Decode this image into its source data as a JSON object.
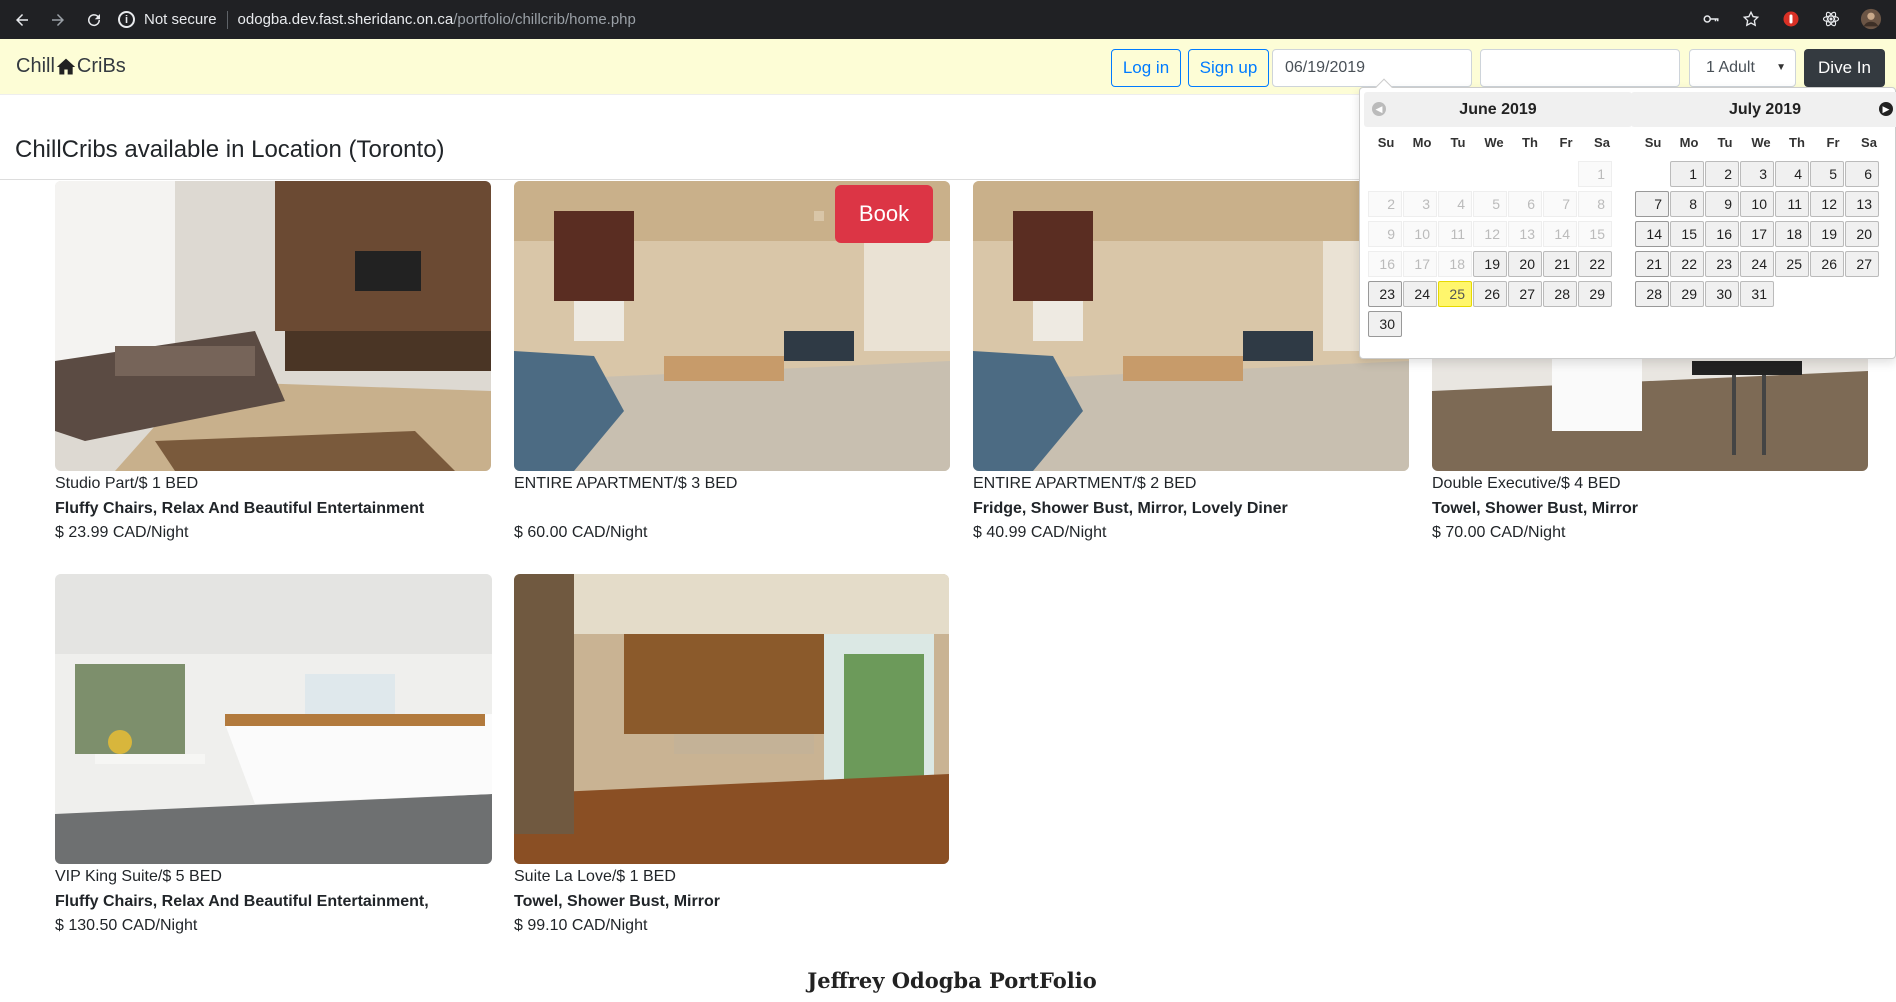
{
  "browser": {
    "security_label": "Not secure",
    "url_host": "odogba.dev.fast.sheridanc.on.ca",
    "url_path": "/portfolio/chillcrib/home.php"
  },
  "navbar": {
    "brand_left": "Chill",
    "brand_right": "CriBs",
    "login_label": "Log in",
    "signup_label": "Sign up",
    "checkin_value": "06/19/2019",
    "checkout_value": "",
    "guests_selected": "1 Adult",
    "dive_label": "Dive In"
  },
  "page": {
    "title": "ChillCribs available in Location (Toronto)"
  },
  "listings": [
    {
      "type": "Studio Part/$ 1 BED",
      "amenities": "Fluffy Chairs, Relax And Beautiful Entertainment",
      "price": "$ 23.99 CAD/Night"
    },
    {
      "type": "ENTIRE APARTMENT/$ 3 BED",
      "amenities": "",
      "price": "$ 60.00 CAD/Night",
      "book_label": "Book"
    },
    {
      "type": "ENTIRE APARTMENT/$ 2 BED",
      "amenities": "Fridge, Shower Bust, Mirror, Lovely Diner",
      "price": "$ 40.99 CAD/Night"
    },
    {
      "type": "Double Executive/$ 4 BED",
      "amenities": "Towel, Shower Bust, Mirror",
      "price": "$ 70.00 CAD/Night"
    },
    {
      "type": "VIP King Suite/$ 5 BED",
      "amenities": "Fluffy Chairs, Relax And Beautiful Entertainment,",
      "price": "$ 130.50 CAD/Night"
    },
    {
      "type": "Suite La Love/$ 1 BED",
      "amenities": "Towel, Shower Bust, Mirror",
      "price": "$ 99.10 CAD/Night"
    }
  ],
  "footer": {
    "title": "Jeffrey Odogba PortFolio"
  },
  "datepicker": {
    "weekday_labels": [
      "Su",
      "Mo",
      "Tu",
      "We",
      "Th",
      "Fr",
      "Sa"
    ],
    "months": [
      {
        "title": "June 2019",
        "first_weekday": 6,
        "days": 30,
        "disabled_before": 19,
        "highlighted": 25
      },
      {
        "title": "July 2019",
        "first_weekday": 1,
        "days": 31,
        "disabled_before": 0,
        "highlighted": null
      }
    ]
  },
  "colors": {
    "navbar_bg": "#fdfdd6",
    "primary": "#007bff",
    "dark": "#343a40",
    "danger": "#dc3545",
    "today": "#fff66c"
  }
}
